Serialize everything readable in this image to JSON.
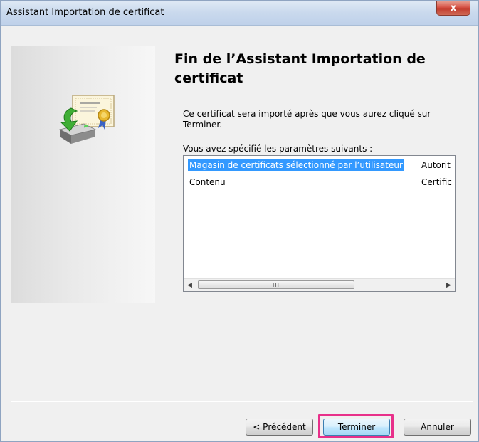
{
  "window": {
    "title": "Assistant Importation de certificat",
    "close_label": "x"
  },
  "content": {
    "heading": "Fin de l’Assistant Importation de certificat",
    "description": "Ce certificat sera importé après que vous aurez cliqué sur Terminer.",
    "params_label": "Vous avez spécifié les paramètres suivants :"
  },
  "settings_list": {
    "rows": [
      {
        "name": "Magasin de certificats sélectionné par l’utilisateur",
        "value": "Autorit",
        "selected": true
      },
      {
        "name": "Contenu",
        "value": "Certific",
        "selected": false
      }
    ],
    "scroll_thumb_glyph": "III"
  },
  "buttons": {
    "previous_prefix": "< ",
    "previous_mnemonic": "P",
    "previous_rest": "récédent",
    "finish": "Terminer",
    "cancel": "Annuler"
  },
  "colors": {
    "selection": "#3399ff",
    "highlight_box": "#e8308a",
    "close_button": "#c23b2c"
  },
  "icons": {
    "wizard": "certificate-import-icon",
    "scroll_left": "scroll-left-arrow-icon",
    "scroll_right": "scroll-right-arrow-icon"
  }
}
